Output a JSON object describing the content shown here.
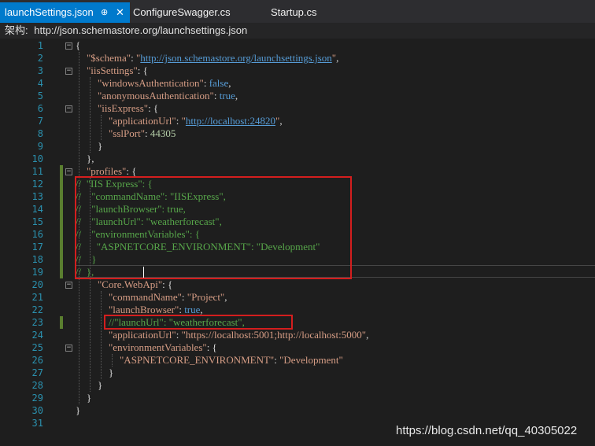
{
  "tabs": [
    {
      "label": "launchSettings.json",
      "active": true,
      "pin": "⊕",
      "close": "✕"
    },
    {
      "label": "ConfigureSwagger.cs",
      "active": false
    },
    {
      "label": "Startup.cs",
      "active": false
    }
  ],
  "schema_bar": {
    "label": "架构:",
    "url": "http://json.schemastore.org/launchsettings.json"
  },
  "colors": {
    "string": "#d69d85",
    "key": "#d69d85",
    "link": "#569cd6",
    "keyword": "#569cd6",
    "number": "#b5cea8",
    "comment": "#57a64a",
    "punct": "#dcdcdc",
    "highlight": "#d41e1e"
  },
  "lines": [
    {
      "n": "1",
      "segs": [
        [
          "p",
          "{"
        ]
      ]
    },
    {
      "n": "2",
      "segs": [
        [
          "k",
          "\"$schema\""
        ],
        [
          "p",
          ": "
        ],
        [
          "s",
          "\""
        ],
        [
          "l",
          "http://json.schemastore.org/launchsettings.json"
        ],
        [
          "s",
          "\""
        ],
        [
          "p",
          ","
        ]
      ]
    },
    {
      "n": "3",
      "segs": [
        [
          "k",
          "\"iisSettings\""
        ],
        [
          "p",
          ": {"
        ]
      ]
    },
    {
      "n": "4",
      "segs": [
        [
          "k",
          "\"windowsAuthentication\""
        ],
        [
          "p",
          ": "
        ],
        [
          "w",
          "false"
        ],
        [
          "p",
          ","
        ]
      ]
    },
    {
      "n": "5",
      "segs": [
        [
          "k",
          "\"anonymousAuthentication\""
        ],
        [
          "p",
          ": "
        ],
        [
          "w",
          "true"
        ],
        [
          "p",
          ","
        ]
      ]
    },
    {
      "n": "6",
      "segs": [
        [
          "k",
          "\"iisExpress\""
        ],
        [
          "p",
          ": {"
        ]
      ]
    },
    {
      "n": "7",
      "segs": [
        [
          "k",
          "\"applicationUrl\""
        ],
        [
          "p",
          ": "
        ],
        [
          "s",
          "\""
        ],
        [
          "l",
          "http://localhost:24820"
        ],
        [
          "s",
          "\""
        ],
        [
          "p",
          ","
        ]
      ]
    },
    {
      "n": "8",
      "segs": [
        [
          "k",
          "\"sslPort\""
        ],
        [
          "p",
          ": "
        ],
        [
          "d",
          "44305"
        ]
      ]
    },
    {
      "n": "9",
      "segs": [
        [
          "p",
          "}"
        ]
      ]
    },
    {
      "n": "10",
      "segs": [
        [
          "p",
          "},"
        ]
      ]
    },
    {
      "n": "11",
      "segs": [
        [
          "k",
          "\"profiles\""
        ],
        [
          "p",
          ": {"
        ]
      ]
    },
    {
      "n": "12",
      "segs": [
        [
          "c",
          "//  \"IIS Express\": {"
        ]
      ]
    },
    {
      "n": "13",
      "segs": [
        [
          "c",
          "//    \"commandName\": \"IISExpress\","
        ]
      ]
    },
    {
      "n": "14",
      "segs": [
        [
          "c",
          "//    \"launchBrowser\": true,"
        ]
      ]
    },
    {
      "n": "15",
      "segs": [
        [
          "c",
          "//    \"launchUrl\": \"weatherforecast\","
        ]
      ]
    },
    {
      "n": "16",
      "segs": [
        [
          "c",
          "//    \"environmentVariables\": {"
        ]
      ]
    },
    {
      "n": "17",
      "segs": [
        [
          "c",
          "//      \"ASPNETCORE_ENVIRONMENT\": \"Development\""
        ]
      ]
    },
    {
      "n": "18",
      "segs": [
        [
          "c",
          "//    }"
        ]
      ]
    },
    {
      "n": "19",
      "segs": [
        [
          "c",
          "//  },"
        ]
      ]
    },
    {
      "n": "20",
      "segs": [
        [
          "k",
          "\"Core.WebApi\""
        ],
        [
          "p",
          ": {"
        ]
      ]
    },
    {
      "n": "21",
      "segs": [
        [
          "k",
          "\"commandName\""
        ],
        [
          "p",
          ": "
        ],
        [
          "s",
          "\"Project\""
        ],
        [
          "p",
          ","
        ]
      ]
    },
    {
      "n": "22",
      "segs": [
        [
          "k",
          "\"launchBrowser\""
        ],
        [
          "p",
          ": "
        ],
        [
          "w",
          "true"
        ],
        [
          "p",
          ","
        ]
      ]
    },
    {
      "n": "23",
      "segs": [
        [
          "c",
          "//\"launchUrl\": \"weatherforecast\","
        ]
      ]
    },
    {
      "n": "24",
      "segs": [
        [
          "k",
          "\"applicationUrl\""
        ],
        [
          "p",
          ": "
        ],
        [
          "s",
          "\"https://localhost:5001;http://localhost:5000\""
        ],
        [
          "p",
          ","
        ]
      ]
    },
    {
      "n": "25",
      "segs": [
        [
          "k",
          "\"environmentVariables\""
        ],
        [
          "p",
          ": {"
        ]
      ]
    },
    {
      "n": "26",
      "segs": [
        [
          "k",
          "\"ASPNETCORE_ENVIRONMENT\""
        ],
        [
          "p",
          ": "
        ],
        [
          "s",
          "\"Development\""
        ]
      ]
    },
    {
      "n": "27",
      "segs": [
        [
          "p",
          "}"
        ]
      ]
    },
    {
      "n": "28",
      "segs": [
        [
          "p",
          "}"
        ]
      ]
    },
    {
      "n": "29",
      "segs": [
        [
          "p",
          "}"
        ]
      ]
    },
    {
      "n": "30",
      "segs": [
        [
          "p",
          "}"
        ]
      ]
    },
    {
      "n": "31",
      "segs": []
    }
  ],
  "watermark": "https://blog.csdn.net/qq_40305022"
}
